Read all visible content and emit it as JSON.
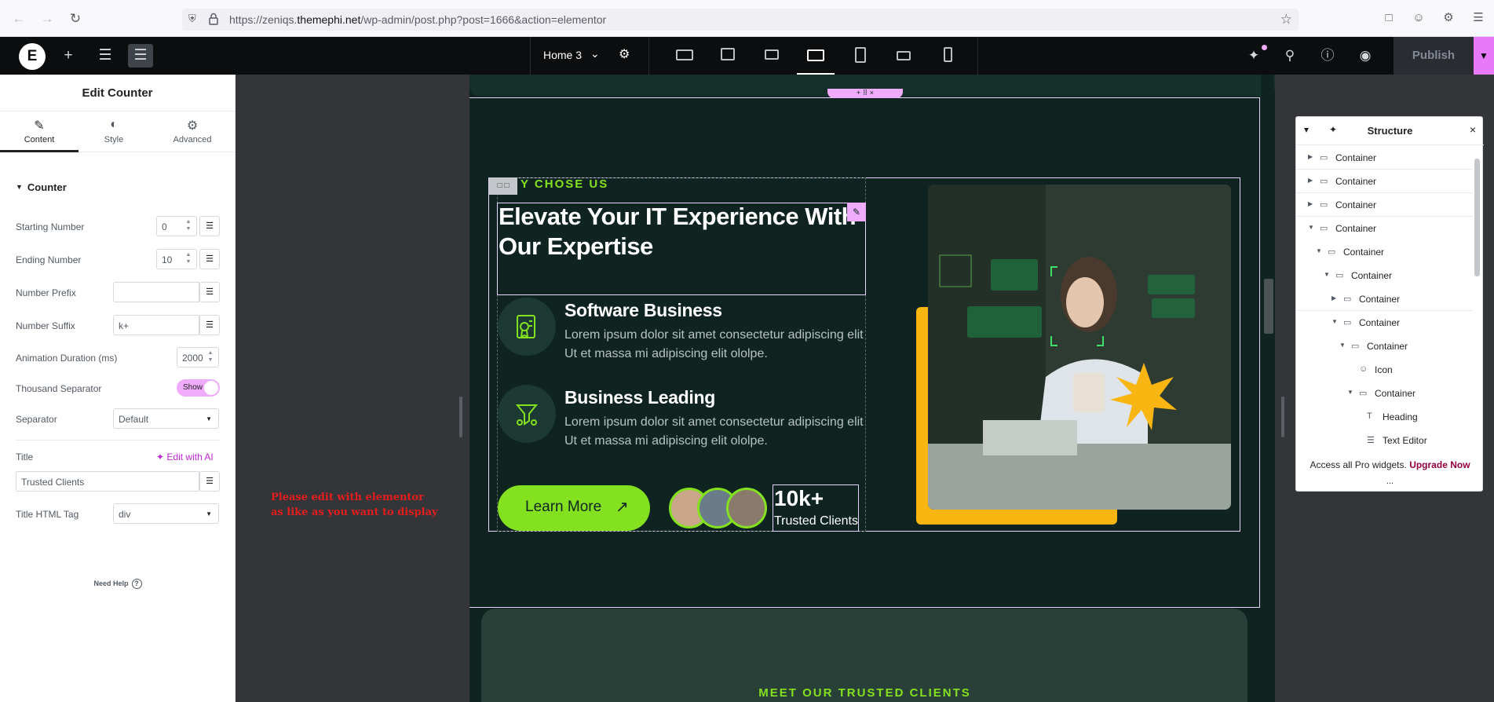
{
  "browser": {
    "url_prefix": "https://zeniqs.",
    "url_domain": "themephi.net",
    "url_suffix": "/wp-admin/post.php?post=1666&action=elementor"
  },
  "topbar": {
    "page_name": "Home 3",
    "publish_label": "Publish"
  },
  "panel": {
    "title": "Edit Counter",
    "tabs": [
      {
        "label": "Content",
        "icon": "pencil-icon",
        "active": true
      },
      {
        "label": "Style",
        "icon": "half-circle-icon",
        "active": false
      },
      {
        "label": "Advanced",
        "icon": "gear-icon",
        "active": false
      }
    ],
    "section_title": "Counter",
    "fields": {
      "starting_number_label": "Starting Number",
      "starting_number_value": "0",
      "ending_number_label": "Ending Number",
      "ending_number_value": "10",
      "number_prefix_label": "Number Prefix",
      "number_prefix_value": "",
      "number_suffix_label": "Number Suffix",
      "number_suffix_value": "k+",
      "animation_duration_label": "Animation Duration (ms)",
      "animation_duration_value": "2000",
      "thousand_separator_label": "Thousand Separator",
      "thousand_separator_value": "Show",
      "separator_label": "Separator",
      "separator_value": "Default",
      "title_label": "Title",
      "edit_with_ai": "Edit with AI",
      "title_value": "Trusted Clients",
      "title_html_tag_label": "Title HTML Tag",
      "title_html_tag_value": "div"
    },
    "need_help": "Need Help",
    "help_mark": "?"
  },
  "canvas": {
    "note_line1": "Please edit with elementor",
    "note_line2": "as like as you want to display",
    "eyebrow": "Y CHOSE US",
    "heading": "Elevate Your IT Experience With Our Expertise",
    "features": [
      {
        "title": "Software Business",
        "text": "Lorem ipsum dolor sit amet consectetur adipiscing elit Ut et massa mi adipiscing elit ololpe."
      },
      {
        "title": "Business Leading",
        "text": "Lorem ipsum dolor sit amet consectetur adipiscing elit Ut et massa mi adipiscing elit ololpe."
      }
    ],
    "button_label": "Learn More",
    "counter_number": "10k+",
    "counter_title": "Trusted Clients",
    "bottom_eyebrow": "MEET OUR TRUSTED CLIENTS",
    "colors": {
      "accent": "#84e11f",
      "background": "#0f2420",
      "yellow": "#f9b612",
      "highlight": "#f0abfc"
    }
  },
  "structure": {
    "title": "Structure",
    "rows": [
      {
        "label": "Container",
        "depth": 0,
        "twisty": "closed",
        "icon": "container-icon"
      },
      {
        "label": "Container",
        "depth": 0,
        "twisty": "closed",
        "icon": "container-icon"
      },
      {
        "label": "Container",
        "depth": 0,
        "twisty": "closed",
        "icon": "container-icon"
      },
      {
        "label": "Container",
        "depth": 0,
        "twisty": "open",
        "icon": "container-icon"
      },
      {
        "label": "Container",
        "depth": 1,
        "twisty": "open",
        "icon": "container-icon"
      },
      {
        "label": "Container",
        "depth": 2,
        "twisty": "open",
        "icon": "container-icon"
      },
      {
        "label": "Container",
        "depth": 3,
        "twisty": "closed",
        "icon": "container-icon"
      },
      {
        "label": "Container",
        "depth": 3,
        "twisty": "open",
        "icon": "container-icon"
      },
      {
        "label": "Container",
        "depth": 4,
        "twisty": "open",
        "icon": "container-icon"
      },
      {
        "label": "Icon",
        "depth": 5,
        "twisty": "none",
        "icon": "smiley-icon"
      },
      {
        "label": "Container",
        "depth": 5,
        "twisty": "open",
        "icon": "container-icon"
      },
      {
        "label": "Heading",
        "depth": 6,
        "twisty": "none",
        "icon": "heading-icon"
      },
      {
        "label": "Text Editor",
        "depth": 6,
        "twisty": "none",
        "icon": "text-editor-icon"
      }
    ],
    "footer_text": "Access all Pro widgets.",
    "footer_link": "Upgrade Now",
    "more": "..."
  }
}
